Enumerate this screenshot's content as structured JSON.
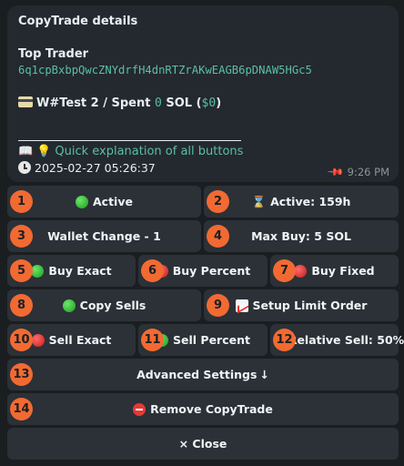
{
  "message": {
    "title": "CopyTrade details",
    "trader_label": "Top Trader",
    "trader_address": "6q1cpBxbpQwcZNYdrfH4dnRTZrAKwEAGB6pDNAW5HGc5",
    "wallet_prefix": "W#Test 2 / Spent ",
    "spent_amount": "0",
    "spent_unit": " SOL (",
    "spent_usd": "$0",
    "spent_close": ")",
    "explain_link": "Quick explanation of all buttons",
    "timestamp": "2025-02-27 05:26:37",
    "time": "9:26 PM"
  },
  "colors": {
    "accent": "#5bbfa5",
    "badge": "#f26a32",
    "button_bg": "#2b3137",
    "bubble_bg": "#23292e"
  },
  "buttons": {
    "b1": {
      "num": "1",
      "label": "Active",
      "icon": "green-circle-icon"
    },
    "b2": {
      "num": "2",
      "label": "Active: 159h",
      "icon": "hourglass-icon"
    },
    "b3": {
      "num": "3",
      "label": "Wallet Change - 1"
    },
    "b4": {
      "num": "4",
      "label": "Max Buy: 5 SOL"
    },
    "b5": {
      "num": "5",
      "label": "Buy Exact",
      "icon": "green-circle-icon"
    },
    "b6": {
      "num": "6",
      "label": "Buy Percent",
      "icon": "red-circle-icon"
    },
    "b7": {
      "num": "7",
      "label": "Buy Fixed",
      "icon": "red-circle-icon"
    },
    "b8": {
      "num": "8",
      "label": "Copy Sells",
      "icon": "green-circle-icon"
    },
    "b9": {
      "num": "9",
      "label": "Setup Limit Order",
      "icon": "chart-icon"
    },
    "b10": {
      "num": "10",
      "label": "Sell Exact",
      "icon": "red-circle-icon"
    },
    "b11": {
      "num": "11",
      "label": "Sell Percent",
      "icon": "green-circle-icon"
    },
    "b12": {
      "num": "12",
      "label": "Relative Sell: 50%"
    },
    "b13": {
      "num": "13",
      "label": "Advanced Settings",
      "icon": "arrow-down-icon"
    },
    "b14": {
      "num": "14",
      "label": "Remove CopyTrade",
      "icon": "no-entry-icon"
    },
    "close": {
      "label": "× Close"
    }
  }
}
